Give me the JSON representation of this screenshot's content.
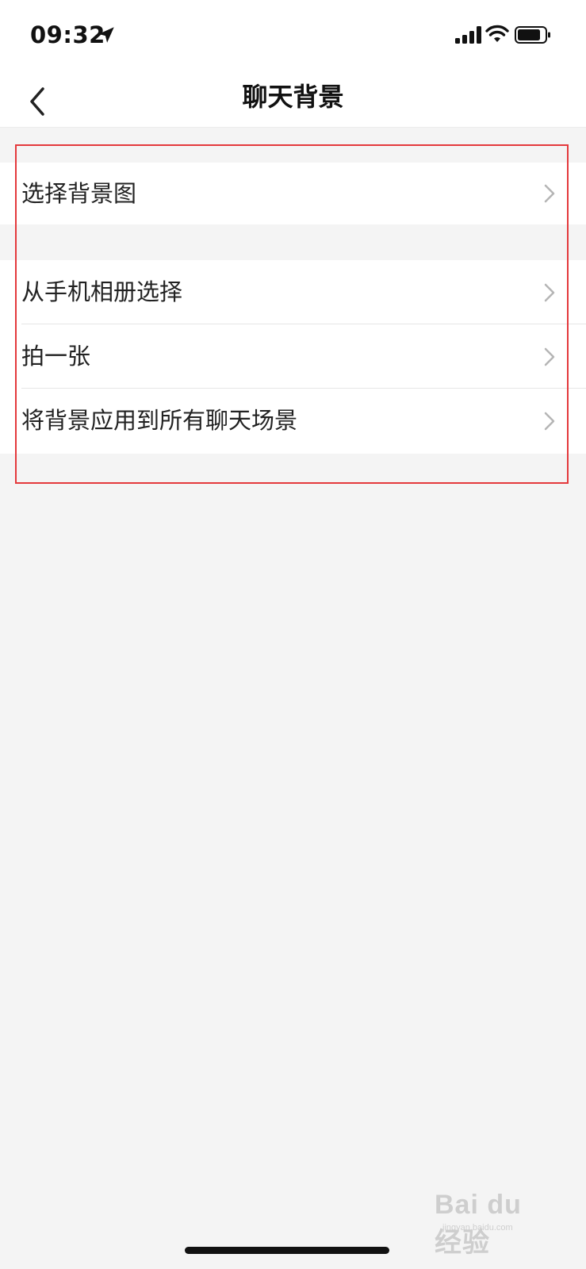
{
  "status_bar": {
    "time": "09:32"
  },
  "nav": {
    "title": "聊天背景"
  },
  "groups": [
    {
      "items": [
        {
          "label": "选择背景图"
        }
      ]
    },
    {
      "items": [
        {
          "label": "从手机相册选择"
        },
        {
          "label": "拍一张"
        },
        {
          "label": "将背景应用到所有聊天场景"
        }
      ]
    }
  ],
  "watermark": {
    "brand": "Bai du 经验",
    "url": "jingyan.baidu.com"
  },
  "colors": {
    "highlight_box": "#e4393c",
    "background": "#f4f4f4",
    "row_background": "#ffffff"
  },
  "icons": {
    "back": "chevron-left-icon",
    "row_arrow": "chevron-right-icon",
    "location": "location-arrow-icon",
    "signal": "cellular-signal-icon",
    "wifi": "wifi-icon",
    "battery": "battery-icon"
  }
}
